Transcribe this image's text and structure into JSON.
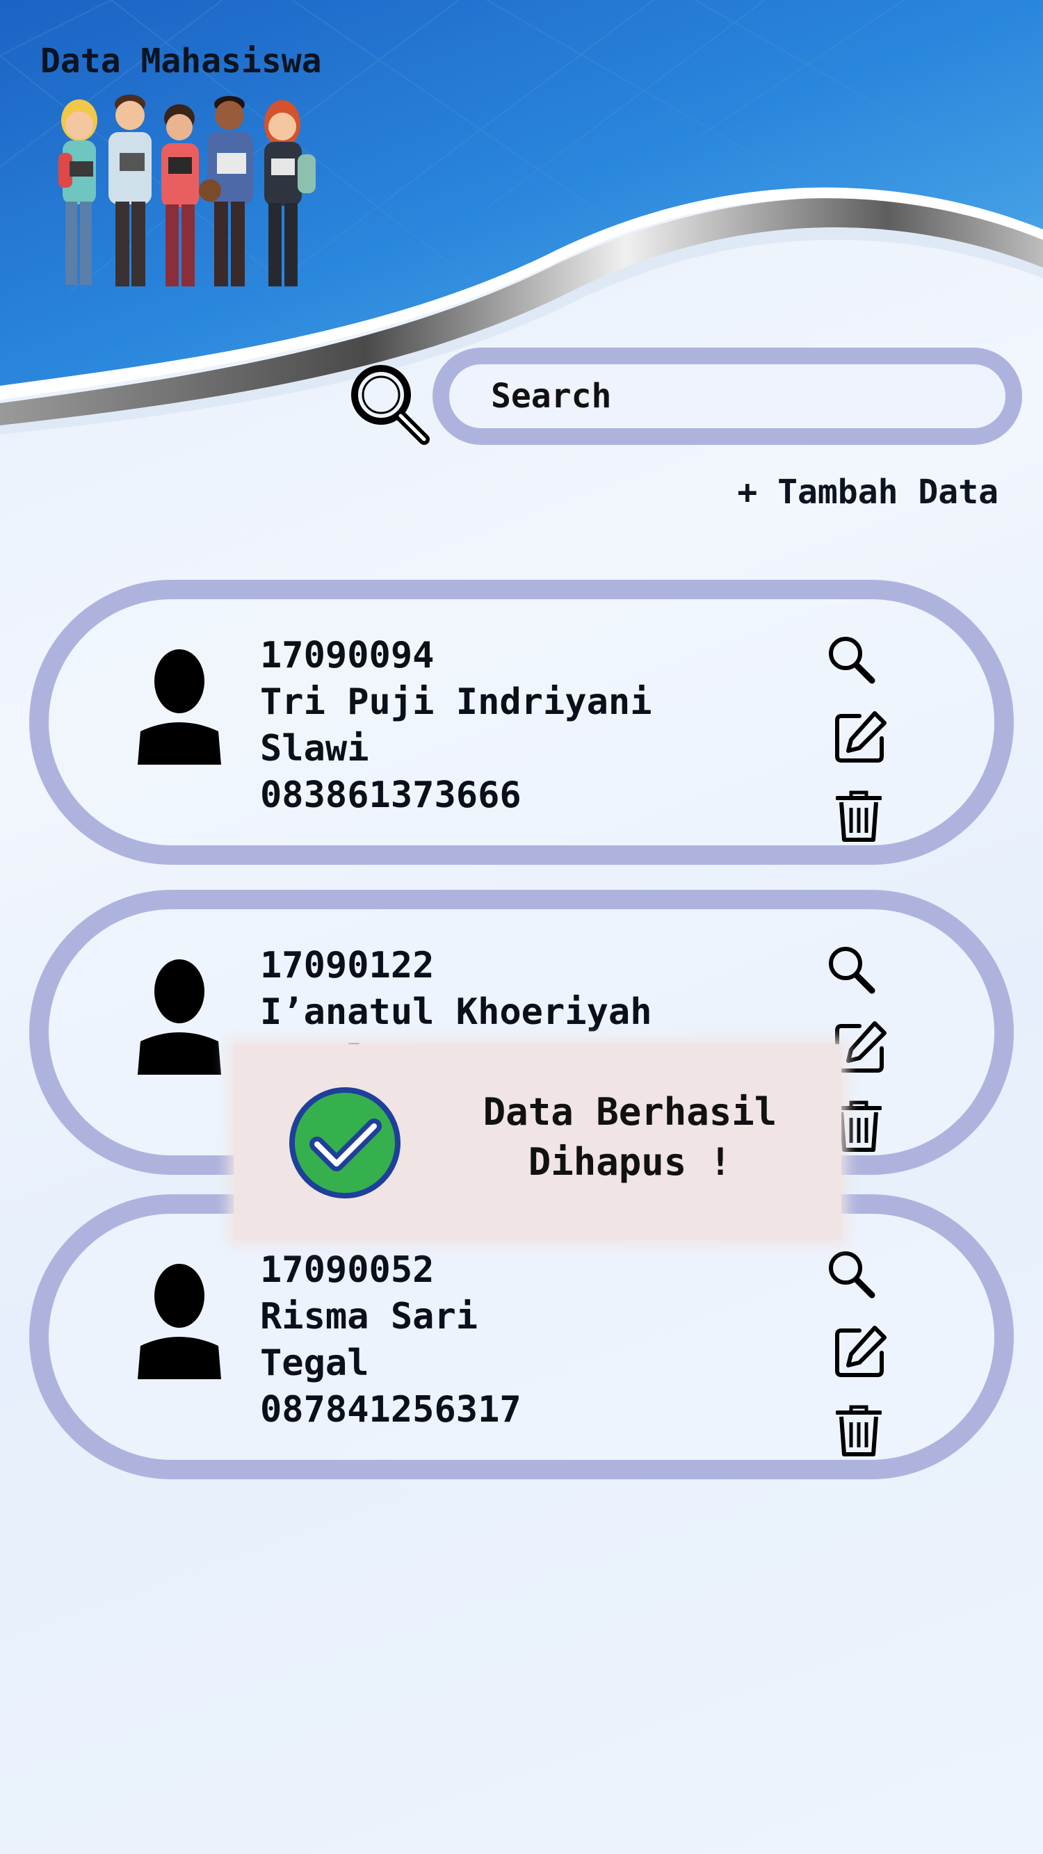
{
  "app": {
    "title": "Data Mahasiswa"
  },
  "search": {
    "placeholder": "Search",
    "value": ""
  },
  "actions": {
    "add_label": "+ Tambah Data"
  },
  "students": [
    {
      "nim": "17090094",
      "name": "Tri Puji Indriyani",
      "city": "Slawi",
      "phone": "083861373666"
    },
    {
      "nim": "17090122",
      "name": "I’anatul Khoeriyah",
      "city": "Pemalang",
      "phone": "0"
    },
    {
      "nim": "17090052",
      "name": "Risma Sari",
      "city": "Tegal",
      "phone": "087841256317"
    }
  ],
  "toast": {
    "line1": "Data Berhasil",
    "line2": "Dihapus !"
  },
  "colors": {
    "header_blue": "#1f6fd0",
    "card_border": "#aeb3de",
    "success_green": "#35b04c",
    "success_ring": "#1e3f9a",
    "toast_bg": "#f0e4e4"
  },
  "icons": [
    "students-illustration",
    "search-icon",
    "user-avatar-icon",
    "detail-search-icon",
    "edit-icon",
    "delete-icon",
    "check-circle-icon"
  ]
}
